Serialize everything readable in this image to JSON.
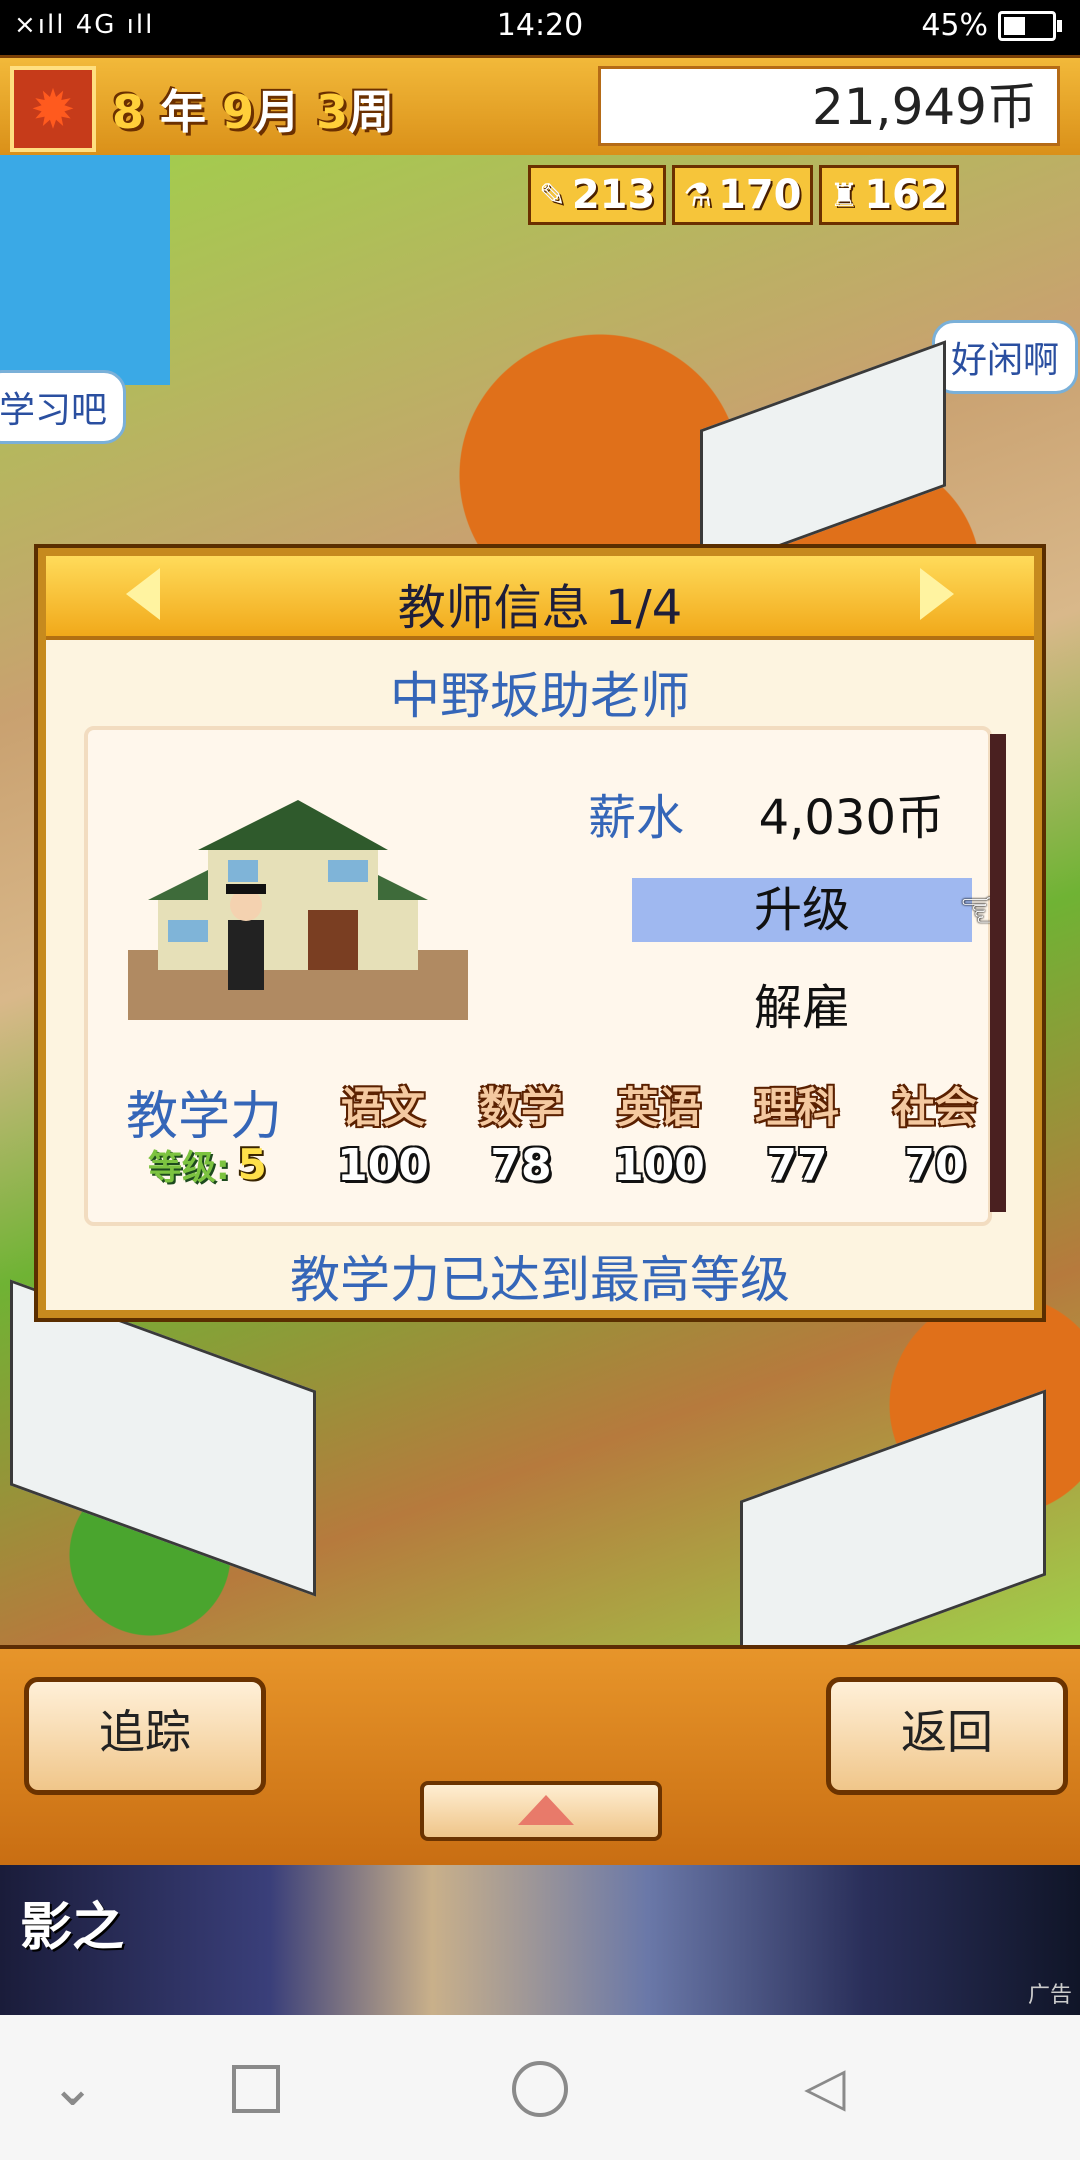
{
  "status_bar": {
    "signal_text": "×ıll 4G ıll ",
    "time": "14:20",
    "battery": "45%"
  },
  "top_bar": {
    "season_icon": "maple-leaf-icon",
    "year_num": "8",
    "year_label": "年",
    "month_num": "9",
    "month_label": "月",
    "week_num": "3",
    "week_label": "周",
    "money": "21,949币"
  },
  "resources": [
    {
      "icon": "pencil-icon",
      "glyph": "✎",
      "value": "213"
    },
    {
      "icon": "flask-icon",
      "glyph": "⚗",
      "value": "170"
    },
    {
      "icon": "bell-icon",
      "glyph": "♜",
      "value": "162"
    }
  ],
  "bubbles": {
    "left": "学习吧",
    "right": "好闲啊"
  },
  "dialog": {
    "title": "教师信息 1/4",
    "teacher_name": "中野坂助老师",
    "salary_label": "薪水",
    "salary_value": "4,030币",
    "upgrade_label": "升级",
    "fire_label": "解雇",
    "power_label": "教学力",
    "subjects": [
      "语文",
      "数学",
      "英语",
      "理科",
      "社会"
    ],
    "level_label": "等级:",
    "level_value": "5",
    "scores": [
      "100",
      "78",
      "100",
      "77",
      "70"
    ],
    "max_note": "教学力已达到最高等级"
  },
  "controls": {
    "track_label": "追踪",
    "back_label": "返回"
  },
  "ad": {
    "title": "影之",
    "tag": "广告"
  },
  "nav": {
    "back": "◁",
    "home": "",
    "recent": "",
    "down": "⌄"
  },
  "colors": {
    "accent_blue": "#3566b8",
    "highlight": "#9fb8f0",
    "frame_gold": "#c68a1e"
  }
}
